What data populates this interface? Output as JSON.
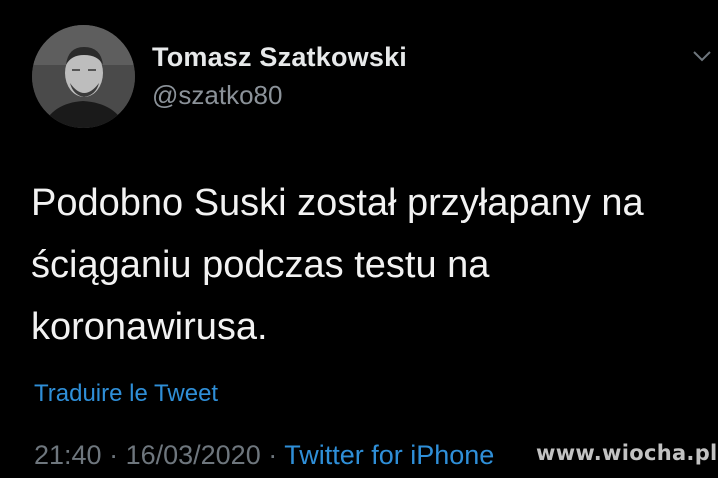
{
  "author": {
    "display_name": "Tomasz Szatkowski",
    "handle": "@szatko80",
    "avatar_icon": "profile-photo"
  },
  "tweet": {
    "text": "Podobno Suski został przyłapany na ściąganiu podczas testu na koronawirusa.",
    "translate_label": "Traduire le Tweet",
    "time": "21:40",
    "separator_1": " · ",
    "date": "16/03/2020",
    "separator_2": " · ",
    "source": "Twitter for iPhone"
  },
  "icons": {
    "menu": "chevron-down-icon"
  },
  "watermark": "www.wiocha.pl",
  "colors": {
    "background": "#000000",
    "primary_text": "#e7e9ea",
    "secondary_text": "#6e767d",
    "link": "#2f8fd8"
  }
}
